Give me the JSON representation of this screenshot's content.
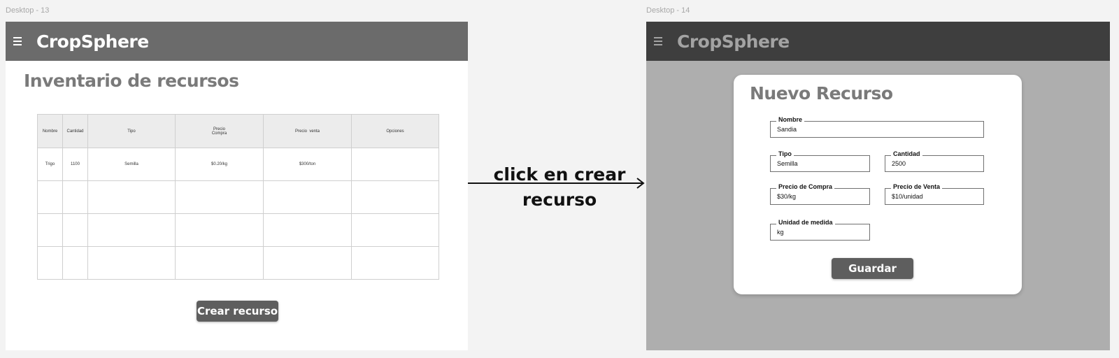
{
  "desktop13": {
    "frame_label": "Desktop - 13",
    "app_title": "CropSphere",
    "page_title": "Inventario de recursos",
    "table": {
      "headers": [
        "Nombre",
        "Cantidad",
        "Tipo",
        "Precio\nCompra",
        "Precio  venta",
        "Opciones"
      ],
      "rows": [
        [
          "Trigo",
          "1100",
          "Semilla",
          "$0.20/kg",
          "$300/ton",
          ""
        ],
        [
          "",
          "",
          "",
          "",
          "",
          ""
        ],
        [
          "",
          "",
          "",
          "",
          "",
          ""
        ],
        [
          "",
          "",
          "",
          "",
          "",
          ""
        ]
      ]
    },
    "create_button": "Crear recurso"
  },
  "annotation": {
    "line1": "click en crear",
    "line2": "recurso"
  },
  "desktop14": {
    "frame_label": "Desktop - 14",
    "app_title": "CropSphere",
    "dialog": {
      "title": "Nuevo Recurso",
      "fields": {
        "nombre": {
          "label": "Nombre",
          "value": "Sandia"
        },
        "tipo": {
          "label": "Tipo",
          "value": "Semilla"
        },
        "cantidad": {
          "label": "Cantidad",
          "value": "2500"
        },
        "precio_compra": {
          "label": "Precio de Compra",
          "value": "$30/kg"
        },
        "precio_venta": {
          "label": "Precio de Venta",
          "value": "$10/unidad"
        },
        "unidad": {
          "label": "Unidad de medida",
          "value": "kg"
        }
      },
      "save_button": "Guardar"
    }
  }
}
